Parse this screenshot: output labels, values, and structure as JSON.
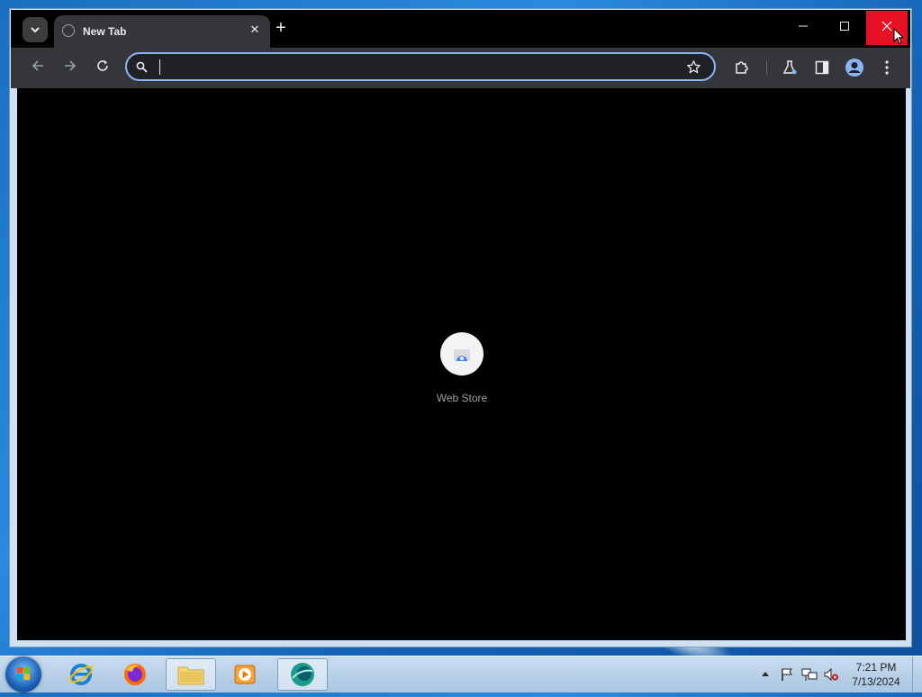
{
  "browser": {
    "tab": {
      "title": "New Tab"
    },
    "window_controls": {
      "minimize": "—",
      "maximize": "☐",
      "close": "✕"
    },
    "omnibox": {
      "value": "",
      "placeholder": ""
    },
    "icons": [
      "tab-search-icon",
      "globe-icon",
      "close-icon",
      "plus-icon",
      "back-icon",
      "forward-icon",
      "reload-icon",
      "search-icon",
      "star-icon",
      "extensions-icon",
      "labs-icon",
      "side-panel-icon",
      "profile-icon",
      "menu-icon"
    ]
  },
  "newtab": {
    "shortcuts": [
      {
        "label": "Web Store"
      }
    ]
  },
  "taskbar": {
    "apps": [
      "internet-explorer",
      "firefox",
      "file-explorer",
      "media-player",
      "chrome-like-app"
    ],
    "clock": {
      "time": "7:21 PM",
      "date": "7/13/2024"
    }
  },
  "colors": {
    "accent": "#8ab4f8",
    "close_hover": "#e81123",
    "toolbar": "#35363a",
    "titlebar": "#000000"
  }
}
